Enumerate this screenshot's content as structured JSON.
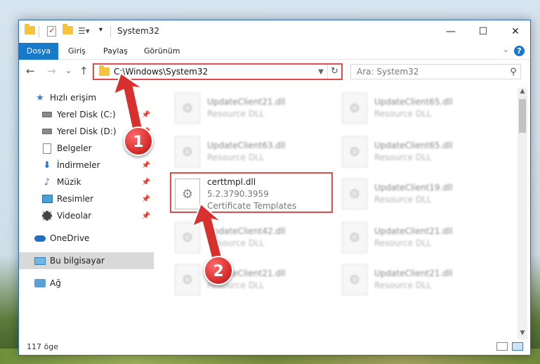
{
  "window": {
    "title": "System32",
    "controls": {
      "minimize": "—",
      "maximize": "☐",
      "close": "✕"
    }
  },
  "ribbon": {
    "tabs": [
      {
        "label": "Dosya",
        "active": true
      },
      {
        "label": "Giriş",
        "active": false
      },
      {
        "label": "Paylaş",
        "active": false
      },
      {
        "label": "Görünüm",
        "active": false
      }
    ],
    "help": "?"
  },
  "navigation": {
    "back": "←",
    "forward": "→",
    "recent": "⌄",
    "up": "↑",
    "address": "C:\\Windows\\System32",
    "search_placeholder": "Ara: System32"
  },
  "sidebar": {
    "items": [
      {
        "label": "Hızlı erişim",
        "icon": "star-icon",
        "pinned": false
      },
      {
        "label": "Yerel Disk (C:)",
        "icon": "drive-icon",
        "pinned": true
      },
      {
        "label": "Yerel Disk (D:)",
        "icon": "drive-icon",
        "pinned": true
      },
      {
        "label": "Belgeler",
        "icon": "document-icon",
        "pinned": true
      },
      {
        "label": "İndirmeler",
        "icon": "download-icon",
        "pinned": true
      },
      {
        "label": "Müzik",
        "icon": "music-icon",
        "pinned": true
      },
      {
        "label": "Resimler",
        "icon": "pictures-icon",
        "pinned": true
      },
      {
        "label": "Videolar",
        "icon": "videos-icon",
        "pinned": true
      },
      {
        "label": "OneDrive",
        "icon": "cloud-icon",
        "pinned": false
      },
      {
        "label": "Bu bilgisayar",
        "icon": "computer-icon",
        "pinned": false,
        "selected": true
      },
      {
        "label": "Ağ",
        "icon": "network-icon",
        "pinned": false
      }
    ]
  },
  "files": [
    {
      "name": "UpdateClient21.dll",
      "type": "Resource DLL",
      "faded": true
    },
    {
      "name": "UpdateClient65.dll",
      "type": "Resource DLL",
      "faded": true
    },
    {
      "name": "UpdateClient63.dll",
      "type": "Resource DLL",
      "faded": true
    },
    {
      "name": "UpdateClient65.dll",
      "type": "Resource DLL",
      "faded": true
    },
    {
      "name": "certtmpl.dll",
      "version": "5.2.3790.3959",
      "type": "Certificate Templates",
      "faded": false,
      "highlighted": true
    },
    {
      "name": "UpdateClient19.dll",
      "type": "Resource DLL",
      "faded": true
    },
    {
      "name": "UpdateClient42.dll",
      "type": "Resource DLL",
      "faded": true
    },
    {
      "name": "UpdateClient21.dll",
      "type": "Resource DLL",
      "faded": true
    },
    {
      "name": "UpdateClient21.dll",
      "type": "Resource DLL",
      "faded": true
    },
    {
      "name": "UpdateClient21.dll",
      "type": "Resource DLL",
      "faded": true
    }
  ],
  "status": {
    "item_count": "117 öge"
  },
  "callouts": [
    "1",
    "2"
  ],
  "colors": {
    "accent": "#1979ca",
    "callout": "#d8302f",
    "highlight": "#e04a4a"
  }
}
